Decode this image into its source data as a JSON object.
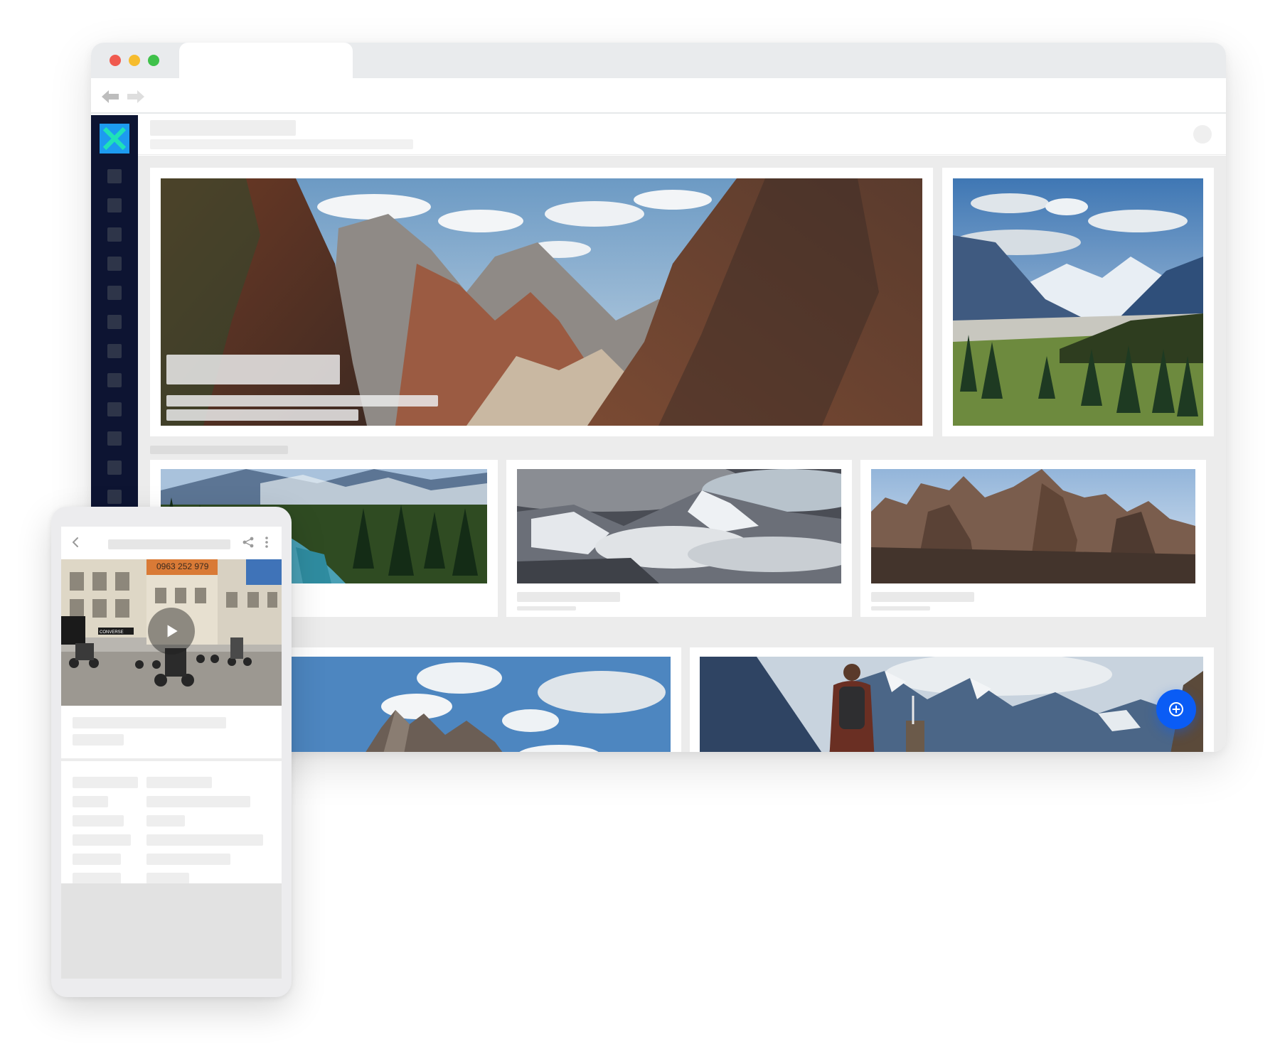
{
  "browser": {
    "window_controls": [
      "close",
      "minimize",
      "maximize"
    ],
    "nav": {
      "back_icon": "arrow-left-icon",
      "forward_icon": "arrow-right-icon"
    }
  },
  "app": {
    "logo_icon": "x-logo-icon",
    "sidebar_item_count": 12,
    "fab_icon": "plus-circle-icon"
  },
  "gallery": {
    "featured": [
      {
        "subject": "Red sandstone canyon with cliffs"
      },
      {
        "subject": "Mountain valley with pine forest"
      }
    ],
    "row2": [
      {
        "subject": "Mountain lake with pine forest"
      },
      {
        "subject": "Snowy peaks above clouds"
      },
      {
        "subject": "Jagged rock spires"
      }
    ],
    "row3": [
      {
        "subject": "Rocky peaks under blue sky"
      },
      {
        "subject": "Hiker looking at mountains"
      }
    ]
  },
  "mobile": {
    "back_icon": "chevron-left-icon",
    "share_icon": "share-icon",
    "more_icon": "more-vertical-icon",
    "video": {
      "sign_text": "0963 252 979",
      "shop_text": "CONVERSE",
      "play_icon": "play-icon"
    }
  },
  "colors": {
    "sidebar": "#0d1432",
    "logo": "#1d9bf0",
    "fab": "#0a5cf5",
    "content_bg": "#ececec"
  }
}
